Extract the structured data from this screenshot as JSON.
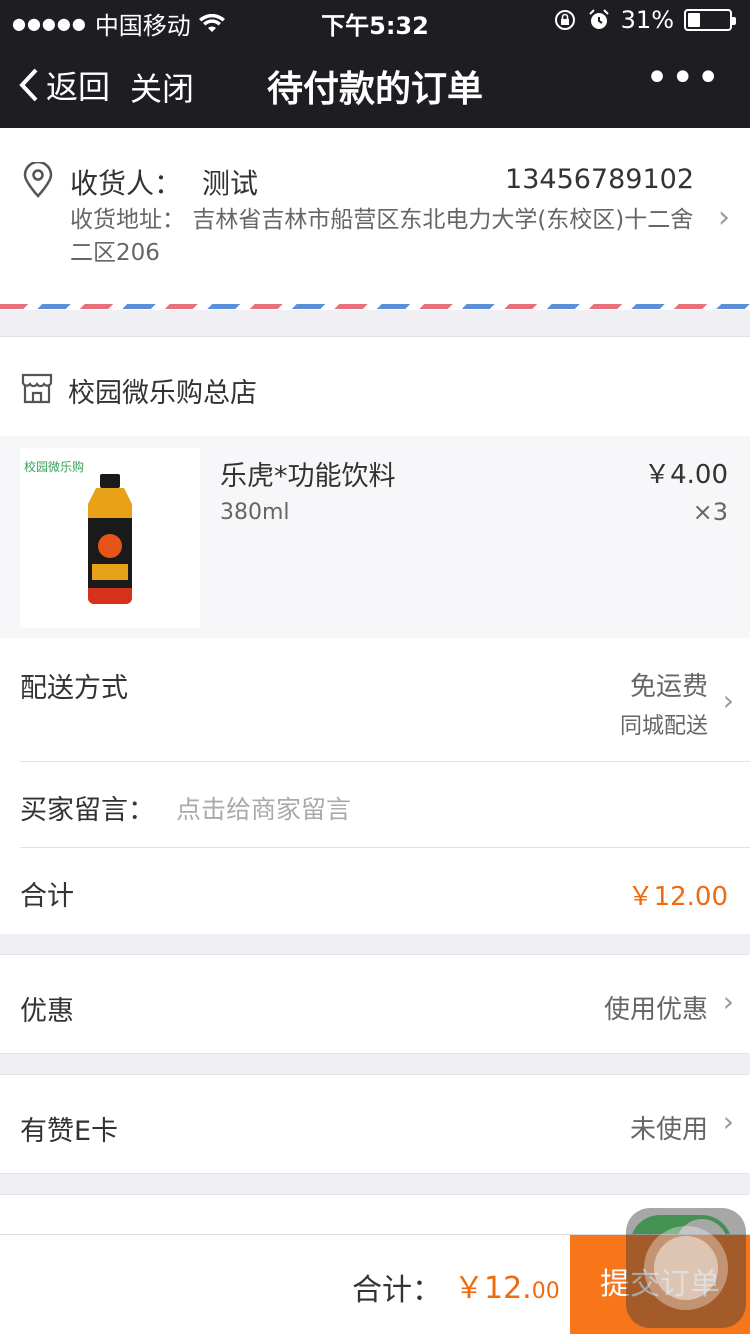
{
  "status_bar": {
    "signal": "●●●●●",
    "carrier": "中国移动",
    "time": "下午5:32",
    "battery_percent": "31%",
    "battery_level": 0.31
  },
  "nav": {
    "back_label": "返回",
    "close_label": "关闭",
    "title": "待付款的订单",
    "more_label": "•••"
  },
  "address": {
    "recipient_label": "收货人：",
    "recipient_name": "测试",
    "phone": "13456789102",
    "address_label": "收货地址：",
    "address_text": "吉林省吉林市船营区东北电力大学(东校区)十二舍二区206"
  },
  "shop": {
    "name": "校园微乐购总店"
  },
  "product": {
    "image_brand_text": "校园微乐购",
    "name": "乐虎*功能饮料",
    "spec": "380ml",
    "price": "￥4.00",
    "quantity": "×3"
  },
  "delivery": {
    "label": "配送方式",
    "fee": "免运费",
    "method": "同城配送"
  },
  "message": {
    "label": "买家留言：",
    "placeholder": "点击给商家留言"
  },
  "total": {
    "label": "合计",
    "value": "￥12.00"
  },
  "coupon": {
    "label": "优惠",
    "value": "使用优惠"
  },
  "ecard": {
    "label": "有赞E卡",
    "value": "未使用"
  },
  "bottom_bar": {
    "total_label": "合计：",
    "price_main": "￥12.",
    "price_decimal": "00",
    "submit_label": "提交订单"
  },
  "colors": {
    "accent_orange": "#f06a0f",
    "submit_button": "#f8751a",
    "toggle_on": "#4cd964",
    "nav_background": "#1e1e22"
  }
}
